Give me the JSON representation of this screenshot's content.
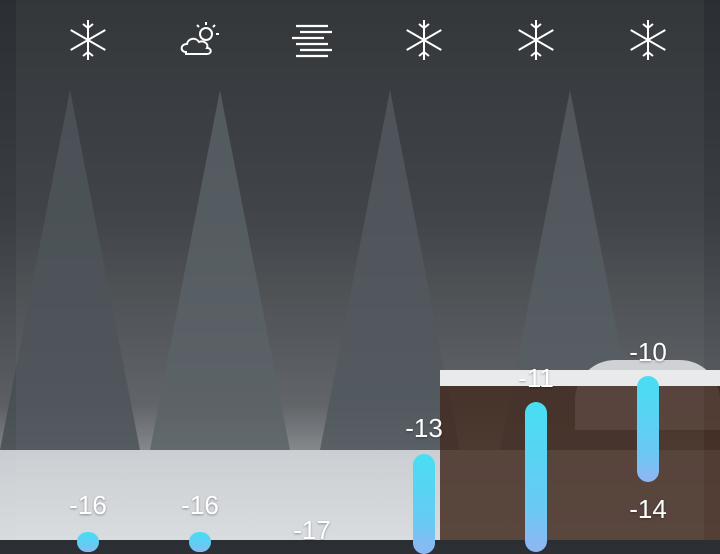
{
  "forecast": {
    "columns": [
      {
        "icon": "snow-icon",
        "high": "-16"
      },
      {
        "icon": "partly-cloudy-day-icon",
        "high": "-16"
      },
      {
        "icon": "fog-icon",
        "high": "-17"
      },
      {
        "icon": "snow-icon",
        "high": "-13"
      },
      {
        "icon": "snow-icon",
        "high": "-11"
      },
      {
        "icon": "snow-icon",
        "high": "-10",
        "low": "-14"
      }
    ],
    "temperature_range": {
      "high": [
        -16,
        -16,
        -17,
        -13,
        -11,
        -10
      ],
      "low_visible_only_last": -14
    }
  },
  "colors": {
    "bar_top": "#48def3",
    "bar_bottom": "#8fb6f2",
    "text": "#ffffff"
  }
}
